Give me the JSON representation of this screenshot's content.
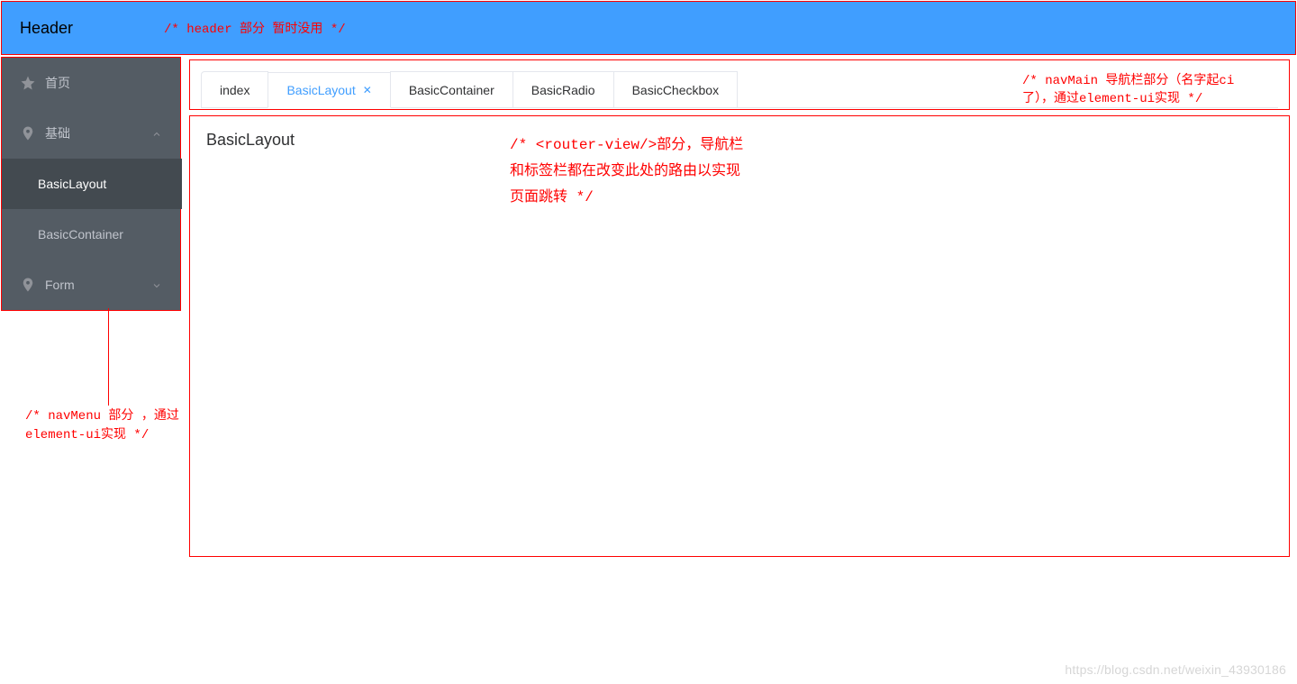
{
  "header": {
    "title": "Header",
    "annotation": "/* header 部分 暂时没用 */"
  },
  "sidebar": {
    "items": [
      {
        "icon": "star-icon",
        "label": "首页",
        "kind": "item"
      },
      {
        "icon": "location-icon",
        "label": "基础",
        "kind": "submenu",
        "expanded": true
      },
      {
        "label": "BasicLayout",
        "kind": "sub",
        "active": true
      },
      {
        "label": "BasicContainer",
        "kind": "sub"
      },
      {
        "icon": "location-icon",
        "label": "Form",
        "kind": "submenu",
        "expanded": false
      }
    ],
    "annotation": "/* navMenu 部分 ，通过element-ui实现 */"
  },
  "tabs": {
    "items": [
      {
        "label": "index"
      },
      {
        "label": "BasicLayout",
        "active": true,
        "closable": true
      },
      {
        "label": "BasicContainer"
      },
      {
        "label": "BasicRadio"
      },
      {
        "label": "BasicCheckbox"
      }
    ],
    "annotation": "/* navMain 导航栏部分（名字起ci了），通过element-ui实现 */"
  },
  "routerView": {
    "title": "BasicLayout",
    "annotation": "/* <router-view/>部分，导航栏和标签栏都在改变此处的路由以实现页面跳转 */"
  },
  "watermark": "https://blog.csdn.net/weixin_43930186"
}
